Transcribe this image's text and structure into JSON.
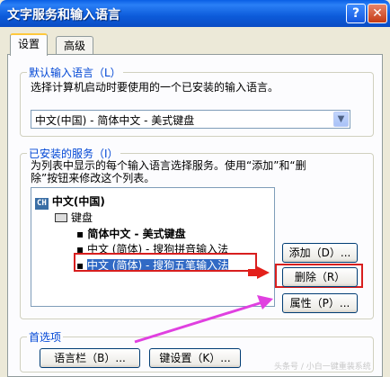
{
  "window": {
    "title": "文字服务和输入语言",
    "help": "?",
    "close": "✕"
  },
  "tabs": [
    {
      "label": "设置"
    },
    {
      "label": "高级"
    }
  ],
  "default_lang": {
    "title": "默认输入语言（L）",
    "desc": "选择计算机启动时要使用的一个已安装的输入语言。",
    "value": "中文(中国) - 简体中文 - 美式键盘"
  },
  "services": {
    "title": "已安装的服务（I）",
    "desc1": "为列表中显示的每个输入语言选择服务。使用“添加”和“删",
    "desc2": "除”按钮来修改这个列表。",
    "tree": {
      "lang_badge": "CH",
      "lang": "中文(中国)",
      "keyboard": "键盘",
      "items": [
        "简体中文 - 美式键盘",
        "中文 (简体) - 搜狗拼音输入法",
        "中文 (简体) - 搜狗五笔输入法"
      ]
    },
    "buttons": {
      "add": "添加（D）...",
      "remove": "删除（R）",
      "props": "属性（P）..."
    }
  },
  "prefs": {
    "title": "首选项",
    "langbar": "语言栏（B）...",
    "keysettings": "键设置（K）..."
  },
  "watermark": "头条号 / 小白一键重装系统",
  "accent": "#0A5FE5",
  "highlight": "#D81E1E",
  "annotation_arrow": "#E040E0"
}
